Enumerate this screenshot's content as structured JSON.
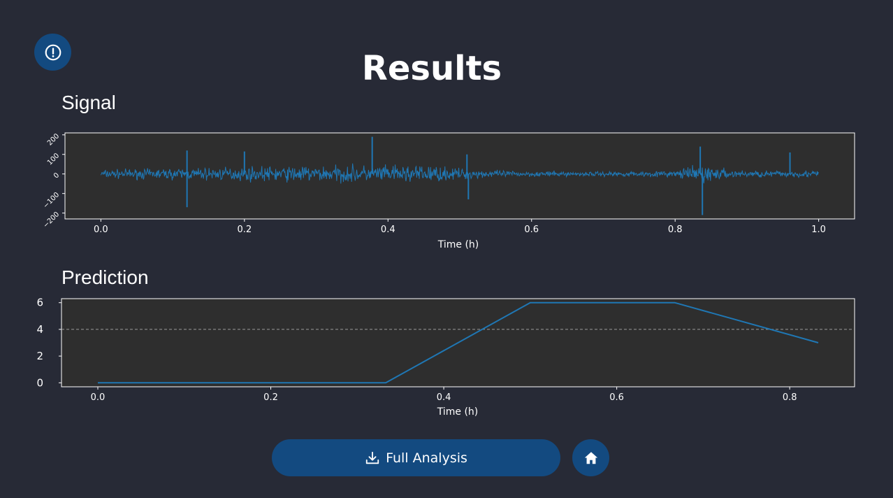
{
  "page": {
    "title": "Results",
    "signal_title": "Signal",
    "prediction_title": "Prediction",
    "full_analysis_label": "Full Analysis"
  },
  "icons": {
    "info": "info-icon",
    "download": "download-icon",
    "home": "home-icon"
  },
  "colors": {
    "background": "#272a36",
    "plot_background": "#2e2e2e",
    "series": "#1f77b4",
    "button": "#134a80",
    "threshold": "#9a9a9a"
  },
  "chart_data": [
    {
      "type": "line",
      "name": "signal",
      "xlabel": "Time (h)",
      "ylabel": "",
      "xlim": [
        -0.05,
        1.05
      ],
      "ylim": [
        -230,
        210
      ],
      "xticks": [
        0.0,
        0.2,
        0.4,
        0.6,
        0.8,
        1.0
      ],
      "xtick_labels": [
        "0.0",
        "0.2",
        "0.4",
        "0.6",
        "0.8",
        "1.0"
      ],
      "yticks": [
        200,
        100,
        0,
        -100,
        -200
      ],
      "ytick_labels": [
        "200",
        "100",
        "0",
        "−100",
        "−200"
      ],
      "envelope": {
        "x": [
          0.0,
          0.05,
          0.1,
          0.15,
          0.2,
          0.25,
          0.3,
          0.35,
          0.4,
          0.45,
          0.5,
          0.55,
          0.6,
          0.65,
          0.7,
          0.75,
          0.8,
          0.83,
          0.84,
          0.86,
          0.9,
          0.95,
          1.0
        ],
        "amplitude": [
          30,
          35,
          40,
          45,
          50,
          55,
          60,
          62,
          60,
          65,
          40,
          25,
          20,
          18,
          18,
          20,
          22,
          60,
          75,
          40,
          25,
          25,
          25
        ]
      },
      "spikes": [
        {
          "x": 0.12,
          "y": -170
        },
        {
          "x": 0.12,
          "y": 120
        },
        {
          "x": 0.2,
          "y": 115
        },
        {
          "x": 0.378,
          "y": 190
        },
        {
          "x": 0.51,
          "y": 100
        },
        {
          "x": 0.512,
          "y": -130
        },
        {
          "x": 0.838,
          "y": -210
        },
        {
          "x": 0.835,
          "y": 140
        },
        {
          "x": 0.96,
          "y": 110
        }
      ]
    },
    {
      "type": "line",
      "name": "prediction",
      "xlabel": "Time (h)",
      "ylabel": "",
      "xlim": [
        -0.042,
        0.875
      ],
      "ylim": [
        -0.3,
        6.3
      ],
      "xticks": [
        0.0,
        0.2,
        0.4,
        0.6,
        0.8
      ],
      "xtick_labels": [
        "0.0",
        "0.2",
        "0.4",
        "0.6",
        "0.8"
      ],
      "yticks": [
        0,
        2,
        4,
        6
      ],
      "ytick_labels": [
        "0",
        "2",
        "4",
        "6"
      ],
      "x": [
        0.0,
        0.333,
        0.5,
        0.667,
        0.833
      ],
      "y": [
        0,
        0,
        6,
        6,
        3
      ],
      "threshold": 4
    }
  ]
}
